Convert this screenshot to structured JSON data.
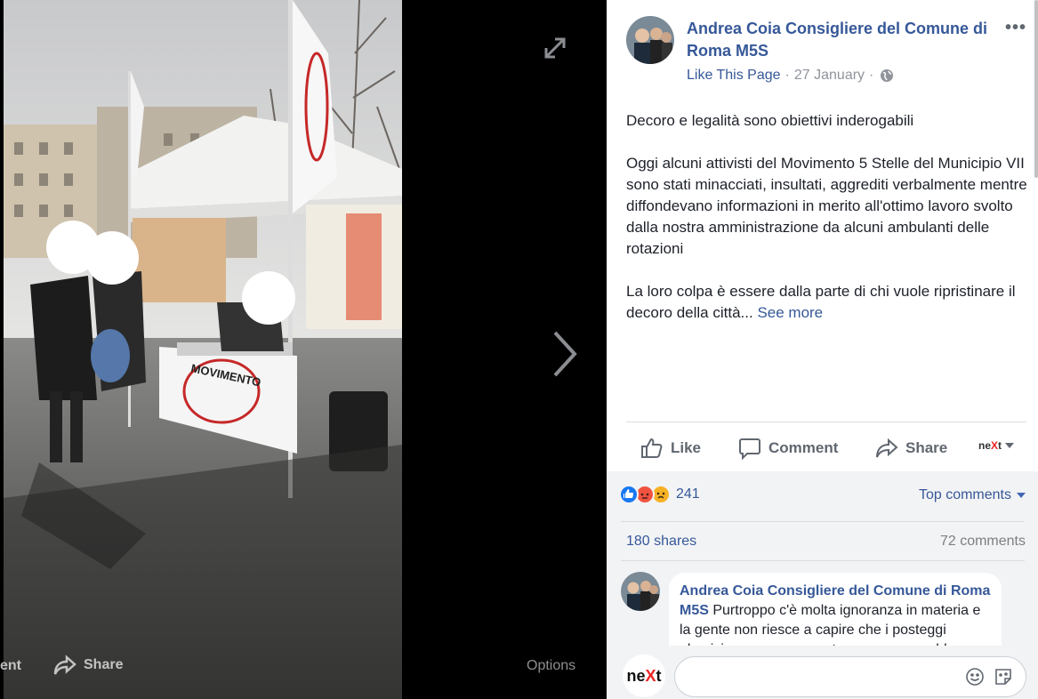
{
  "viewer": {
    "comment_label": "ent",
    "share_label": "Share",
    "options_label": "Options"
  },
  "post": {
    "page_name": "Andrea Coia Consigliere del Comune di Roma M5S",
    "like_page": "Like This Page",
    "date": "27 January",
    "meta_sep": "·",
    "paragraphs": [
      "Decoro e legalità sono obiettivi inderogabili",
      "Oggi alcuni attivisti del Movimento 5 Stelle del Municipio VII sono stati minacciati, insultati, aggrediti verbalmente mentre diffondevano informazioni in merito all'ottimo lavoro svolto dalla nostra amministrazione da alcuni ambulanti delle rotazioni",
      "La loro colpa è essere dalla parte di chi vuole ripristinare il decoro della città..."
    ],
    "see_more": "See more"
  },
  "actions": {
    "like": "Like",
    "comment": "Comment",
    "share": "Share",
    "next_logo_a": "ne",
    "next_logo_x": "X",
    "next_logo_t": "t"
  },
  "stats": {
    "reaction_count": "241",
    "top_comments": "Top comments",
    "shares": "180 shares",
    "comments": "72 comments"
  },
  "comment": {
    "author": "Andrea Coia Consigliere del Comune di Roma M5S",
    "text": "Purtroppo c'è molta ignoranza in materia e la gente non riesce a capire che i posteggi abusivi non sono un sostegno ma un problema che"
  },
  "composer": {
    "logo_a": "ne",
    "logo_x": "X",
    "logo_t": "t",
    "placeholder": ""
  },
  "colors": {
    "link": "#365899",
    "like_reaction": "#1877f2",
    "angry_reaction": "#f0533f",
    "sad_reaction": "#f7b125"
  },
  "icons": [
    "expand-icon",
    "chevron-right-icon",
    "share-icon",
    "more-icon",
    "globe-icon",
    "like-icon",
    "comment-icon",
    "share-icon",
    "caret-down-icon",
    "emoji-icon",
    "sticker-icon"
  ]
}
